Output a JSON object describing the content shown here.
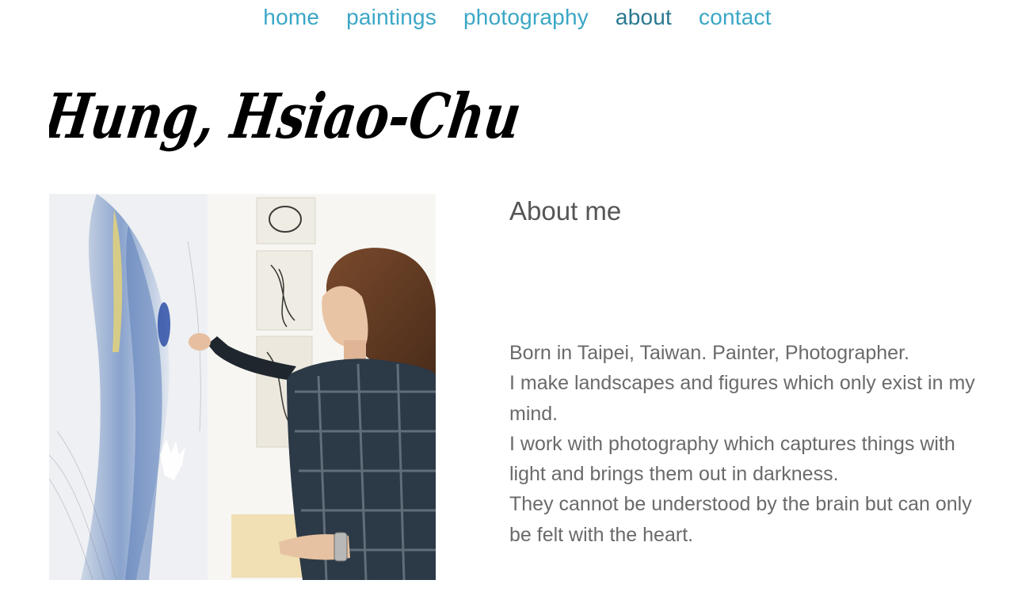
{
  "nav": {
    "items": [
      {
        "label": "home",
        "active": false
      },
      {
        "label": "paintings",
        "active": false
      },
      {
        "label": "photography",
        "active": false
      },
      {
        "label": "about",
        "active": true
      },
      {
        "label": "contact",
        "active": false
      }
    ],
    "color": "#3ba7c6",
    "active_color": "#2a7891"
  },
  "header": {
    "signature_name": "Hung, Hsiao-Chu"
  },
  "photo": {
    "subject": "artist-painting-at-wall-photo"
  },
  "about": {
    "heading": "About me",
    "lines": [
      "Born in Taipei, Taiwan. Painter, Photographer.",
      "I make landscapes and figures which only exist in my mind.",
      "I work with photography which captures things with light and brings them out in darkness.",
      "They cannot be understood by the brain but can only be felt with the heart."
    ]
  }
}
